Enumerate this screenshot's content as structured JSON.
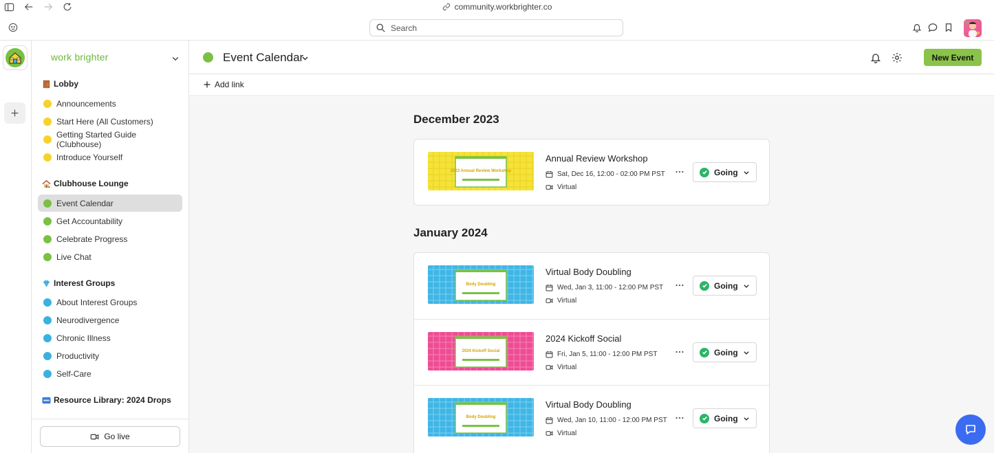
{
  "browser": {
    "url": "community.workbrighter.co",
    "search_placeholder": "Search"
  },
  "sidebar": {
    "brand": "work brighter",
    "groups": [
      {
        "emoji": "door-emoji",
        "label": "Lobby",
        "color": "#f5d32b",
        "items": [
          "Announcements",
          "Start Here (All Customers)",
          "Getting Started Guide (Clubhouse)",
          "Introduce Yourself"
        ]
      },
      {
        "emoji": "house-emoji",
        "label": "Clubhouse Lounge",
        "color": "#7ac143",
        "items": [
          "Event Calendar",
          "Get Accountability",
          "Celebrate Progress",
          "Live Chat"
        ]
      },
      {
        "emoji": "gem-emoji",
        "label": "Interest Groups",
        "color": "#3bb1e0",
        "items": [
          "About Interest Groups",
          "Neurodivergence",
          "Chronic Illness",
          "Productivity",
          "Self-Care"
        ]
      },
      {
        "emoji": "new-emoji",
        "label": "Resource Library: 2024 Drops"
      }
    ],
    "active_item": "Event Calendar",
    "go_live": "Go live"
  },
  "header": {
    "title": "Event Calendar",
    "new_event": "New Event",
    "add_link": "Add link"
  },
  "months": [
    {
      "label": "December 2023",
      "events": [
        {
          "title": "Annual Review Workshop",
          "date": "Sat, Dec 16, 12:00 - 02:00 PM PST",
          "location": "Virtual",
          "rsvp": "Going",
          "thumb": {
            "bg": "#f5e33a",
            "line": "#e9d21d",
            "text": "2023 Annual Review Workshop"
          }
        }
      ]
    },
    {
      "label": "January 2024",
      "events": [
        {
          "title": "Virtual Body Doubling",
          "date": "Wed, Jan 3, 11:00 - 12:00 PM PST",
          "location": "Virtual",
          "rsvp": "Going",
          "thumb": {
            "bg": "#3fb6e6",
            "line": "#7fd0f0",
            "text": "Body Doubling"
          }
        },
        {
          "title": "2024 Kickoff Social",
          "date": "Fri, Jan 5, 11:00 - 12:00 PM PST",
          "location": "Virtual",
          "rsvp": "Going",
          "thumb": {
            "bg": "#ef4c94",
            "line": "#f585b6",
            "text": "2024 Kickoff Social"
          }
        },
        {
          "title": "Virtual Body Doubling",
          "date": "Wed, Jan 10, 11:00 - 12:00 PM PST",
          "location": "Virtual",
          "rsvp": "Going",
          "thumb": {
            "bg": "#3fb6e6",
            "line": "#7fd0f0",
            "text": "Body Doubling"
          }
        }
      ]
    }
  ],
  "colors": {
    "accent": "#8bc34a",
    "brand": "#6bb83a",
    "chat": "#3b6bf0",
    "going": "#2db46a"
  }
}
